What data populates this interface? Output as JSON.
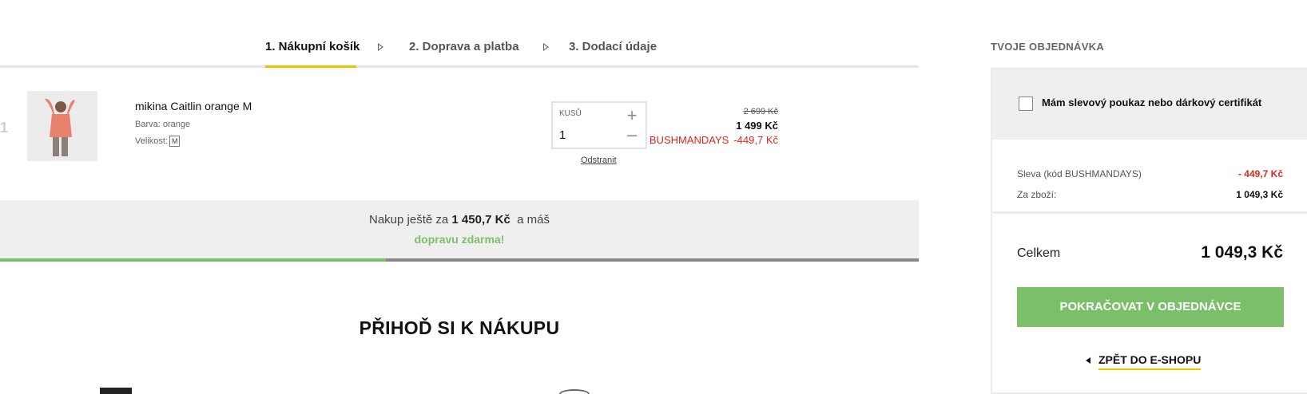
{
  "steps": [
    {
      "label": "1. Nákupní košík",
      "active": true
    },
    {
      "label": "2. Doprava a platba",
      "active": false
    },
    {
      "label": "3. Dodací údaje",
      "active": false
    }
  ],
  "cart": {
    "items": [
      {
        "index": "1",
        "name": "mikina Caitlin orange M",
        "color_label": "Barva: orange",
        "size_label": "Velikost:",
        "size_value": "M",
        "qty_label": "KUSŮ",
        "qty_value": "1",
        "remove_label": "Odstranit",
        "price_old": "2 699 Kč",
        "price_new": "1 499 Kč",
        "discount_code": "BUSHMANDAYS",
        "discount_value": "-449,7 Kč"
      }
    ]
  },
  "shipping": {
    "prefix": "Nakup ještě za",
    "amount": "1 450,7 Kč",
    "suffix": "a máš",
    "line2": "dopravu zdarma!",
    "progress_fraction": 0.42
  },
  "section_title": "PŘIHOĎ SI K NÁKUPU",
  "sidebar": {
    "title": "TVOJE OBJEDNÁVKA",
    "coupon_label": "Mám slevový poukaz nebo dárkový certifikát",
    "discount_label": "Sleva (kód BUSHMANDAYS)",
    "discount_value": "- 449,7 Kč",
    "goods_label": "Za zboží:",
    "goods_value": "1 049,3 Kč",
    "total_label": "Celkem",
    "total_value": "1 049,3 Kč",
    "cta_label": "POKRAČOVAT V OBJEDNÁVCE",
    "back_label": "ZPĚT DO E-SHOPU"
  },
  "colors": {
    "accent_yellow": "#f2c200",
    "green": "#7bbf6a",
    "discount_red": "#e0261a"
  }
}
